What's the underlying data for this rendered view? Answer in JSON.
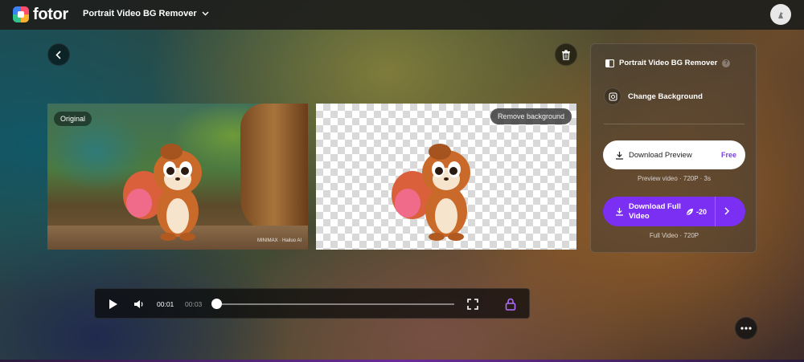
{
  "header": {
    "logo_text": "fotor",
    "tool_menu_label": "Portrait Video BG Remover"
  },
  "preview": {
    "original_label": "Original",
    "remove_bg_label": "Remove background",
    "watermark_text": "MINIMAX · Hailuo AI"
  },
  "side_panel": {
    "title": "Portrait Video BG Remover",
    "change_background_label": "Change Background",
    "download_preview_label": "Download Preview",
    "download_preview_badge": "Free",
    "preview_sub": "Preview video · 720P · 3s",
    "download_full_label": "Download Full Video",
    "download_full_cost": "-20",
    "full_sub": "Full Video · 720P"
  },
  "player": {
    "current_time": "00:01",
    "duration": "00:03",
    "progress": 0
  },
  "colors": {
    "accent": "#7b2ff2",
    "free_badge": "#7b3fe4"
  }
}
